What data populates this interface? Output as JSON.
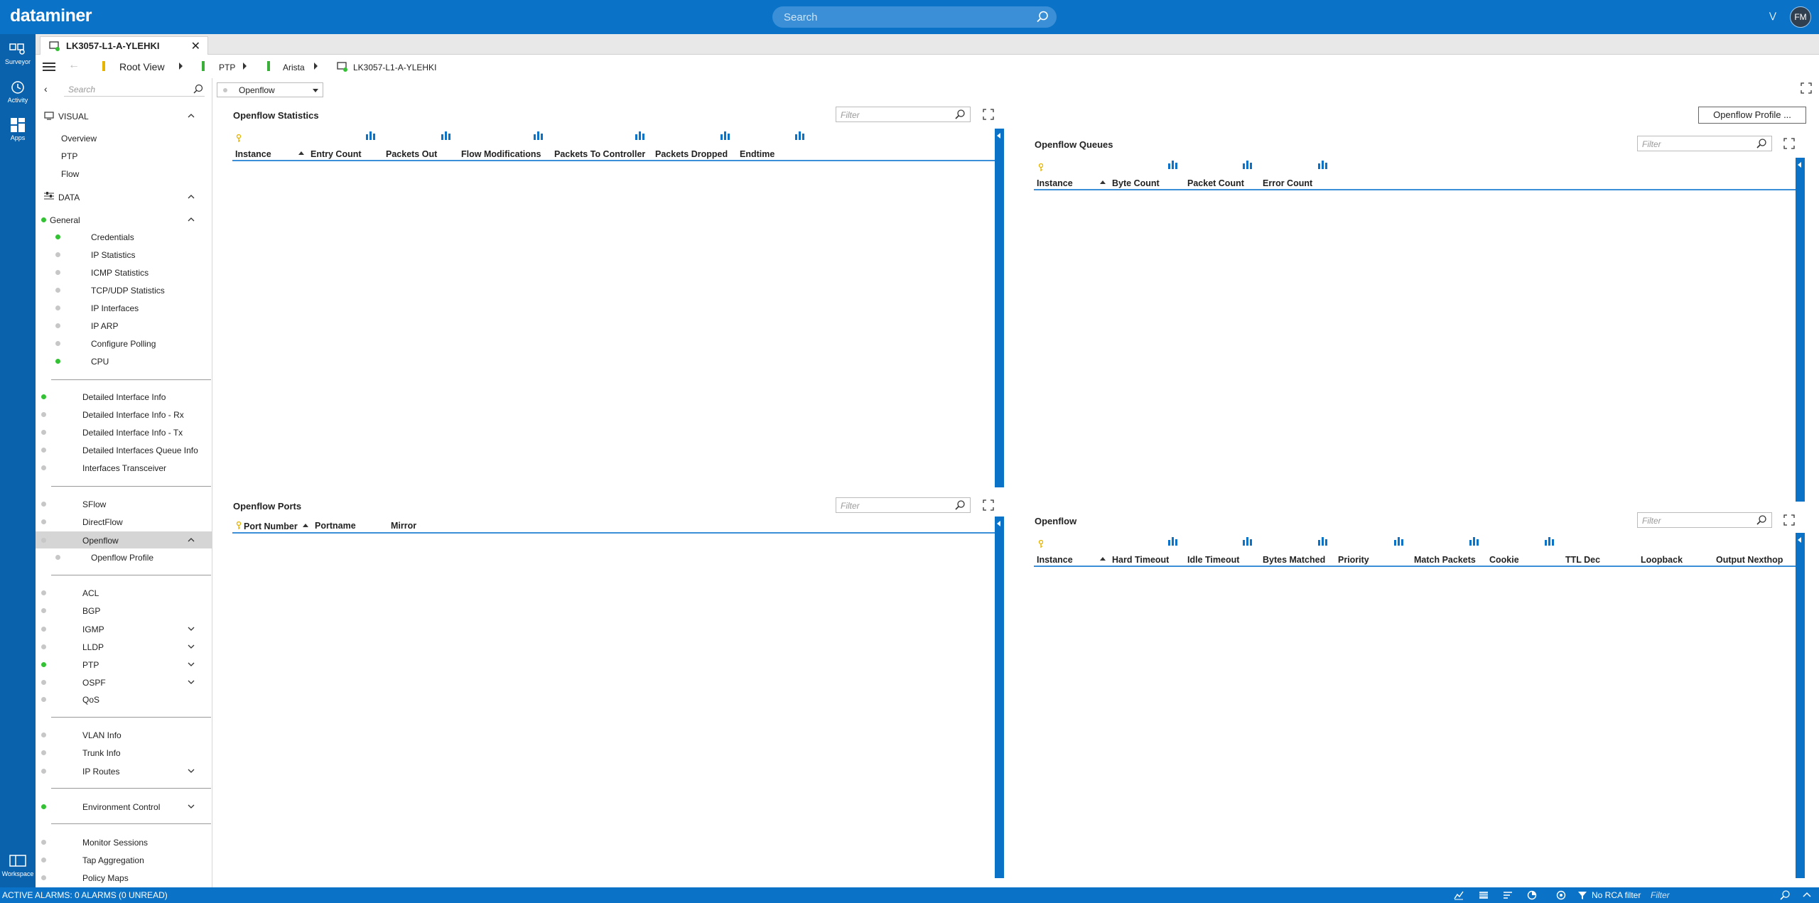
{
  "app": {
    "logo": "dataminer",
    "search_placeholder": "Search",
    "user_initials": "FM"
  },
  "rail": [
    {
      "label": "Surveyor",
      "icon": "surveyor-icon"
    },
    {
      "label": "Activity",
      "icon": "activity-icon"
    },
    {
      "label": "Apps",
      "icon": "apps-icon"
    },
    {
      "label": "Workspace",
      "icon": "workspace-icon"
    }
  ],
  "tab": {
    "title": "LK3057-L1-A-YLEHKI"
  },
  "breadcrumb": {
    "root": "Root View",
    "c1": "PTP",
    "c2": "Arista",
    "c3": "LK3057-L1-A-YLEHKI"
  },
  "sidebar": {
    "search_placeholder": "Search",
    "visual_header": "VISUAL",
    "visual_items": [
      "Overview",
      "PTP",
      "Flow"
    ],
    "data_header": "DATA",
    "general": "General",
    "general_items": [
      "Credentials",
      "IP Statistics",
      "ICMP Statistics",
      "TCP/UDP Statistics",
      "IP Interfaces",
      "IP ARP",
      "Configure Polling",
      "CPU"
    ],
    "group2": [
      "Detailed Interface Info",
      "Detailed Interface Info - Rx",
      "Detailed Interface Info - Tx",
      "Detailed Interfaces Queue Info",
      "Interfaces Transceiver"
    ],
    "group3": [
      "SFlow",
      "DirectFlow",
      "Openflow"
    ],
    "openflow_child": "Openflow Profile",
    "group4": [
      "ACL",
      "BGP",
      "IGMP",
      "LLDP",
      "PTP",
      "OSPF",
      "QoS"
    ],
    "group5": [
      "VLAN Info",
      "Trunk Info",
      "IP Routes"
    ],
    "group6": [
      "Environment Control"
    ],
    "group7": [
      "Monitor Sessions",
      "Tap Aggregation",
      "Policy Maps"
    ]
  },
  "page_selector": "Openflow",
  "filter_placeholder": "Filter",
  "panels": {
    "stats": {
      "title": "Openflow Statistics",
      "columns": [
        "Instance",
        "Entry Count",
        "Packets Out",
        "Flow Modifications",
        "Packets To Controller",
        "Packets Dropped",
        "Endtime"
      ]
    },
    "queues": {
      "title": "Openflow Queues",
      "columns": [
        "Instance",
        "Byte Count",
        "Packet Count",
        "Error Count"
      ]
    },
    "ports": {
      "title": "Openflow Ports",
      "columns": [
        "Port Number",
        "Portname",
        "Mirror"
      ]
    },
    "openflow": {
      "title": "Openflow",
      "columns": [
        "Instance",
        "Hard Timeout",
        "Idle Timeout",
        "Bytes Matched",
        "Priority",
        "Match Packets",
        "Cookie",
        "TTL Dec",
        "Loopback",
        "Output Nexthop"
      ]
    }
  },
  "profile_button": "Openflow Profile ...",
  "status": {
    "alarms": "ACTIVE ALARMS: 0 ALARMS (0 UNREAD)",
    "rca": "No RCA filter",
    "filter_placeholder": "Filter"
  },
  "colors": {
    "brand": "#0a73c8",
    "rail": "#0a62ad",
    "led_green": "#33c233",
    "led_grey": "#c7c7c7"
  }
}
